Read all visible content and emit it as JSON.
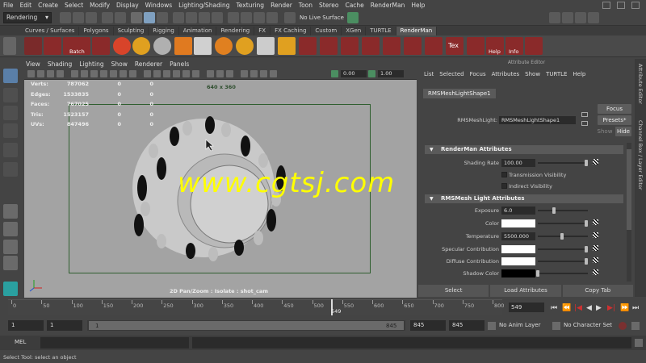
{
  "menubar": [
    "File",
    "Edit",
    "Create",
    "Select",
    "Modify",
    "Display",
    "Windows",
    "Lighting/Shading",
    "Texturing",
    "Render",
    "Toon",
    "Stereo",
    "Cache",
    "RenderMan",
    "Help"
  ],
  "status_line": {
    "mode": "Rendering",
    "live_surface": "No Live Surface"
  },
  "shelf_tabs": [
    "Curves / Surfaces",
    "Polygons",
    "Sculpting",
    "Rigging",
    "Animation",
    "Rendering",
    "FX",
    "FX Caching",
    "Custom",
    "XGen",
    "TURTLE",
    "RenderMan"
  ],
  "shelf_icons": {
    "batch": "Batch",
    "tex": "Tex",
    "help": "Help",
    "info": "Info"
  },
  "viewport": {
    "menu": [
      "View",
      "Shading",
      "Lighting",
      "Show",
      "Renderer",
      "Panels"
    ],
    "toolbar_values": [
      "0.00",
      "1.00"
    ],
    "resolution": "640 x 360",
    "hud": [
      {
        "label": "Verts:",
        "total": "787062",
        "sel": "0",
        "comp": "0"
      },
      {
        "label": "Edges:",
        "total": "1533835",
        "sel": "0",
        "comp": "0"
      },
      {
        "label": "Faces:",
        "total": "767025",
        "sel": "0",
        "comp": "0"
      },
      {
        "label": "Tris:",
        "total": "1523157",
        "sel": "0",
        "comp": "0"
      },
      {
        "label": "UVs:",
        "total": "847496",
        "sel": "0",
        "comp": "0"
      }
    ],
    "footer": "2D Pan/Zoom : Isolate : shot_cam",
    "watermark": "www.cgtsj.com"
  },
  "attribute_editor": {
    "title": "Attribute Editor",
    "menu": [
      "List",
      "Selected",
      "Focus",
      "Attributes",
      "Show",
      "TURTLE",
      "Help"
    ],
    "tab": "RMSMeshLightShape1",
    "node_label": "RMSMeshLight:",
    "node_value": "RMSMeshLightShape1",
    "focus": "Focus",
    "presets": "Presets*",
    "show": "Show",
    "hide": "Hide",
    "sections": {
      "rman": "RenderMan Attributes",
      "light": "RMSMesh  Light Attributes"
    },
    "shading_rate_label": "Shading Rate",
    "shading_rate": "100.00",
    "transmission": "Transmission Visibility",
    "indirect": "Indirect Visibility",
    "exposure_label": "Exposure",
    "exposure": "6.0",
    "color_label": "Color",
    "temperature_label": "Temperature",
    "temperature": "5500.000",
    "specular_label": "Specular Contribution",
    "diffuse_label": "Diffuse Contribution",
    "shadow_label": "Shadow Color",
    "bottom_buttons": [
      "Select",
      "Load Attributes",
      "Copy Tab"
    ],
    "colors": {
      "color_swatch": "#ffffff",
      "shadow_swatch": "#000000"
    }
  },
  "side_tabs": {
    "ae": "Attribute Editor",
    "cb": "Channel Box / Layer Editor"
  },
  "timeline": {
    "ticks": [
      "0",
      "50",
      "100",
      "150",
      "200",
      "250",
      "300",
      "350",
      "400",
      "450",
      "500",
      "550",
      "600",
      "650",
      "700",
      "750",
      "800"
    ],
    "current_marker": "549",
    "current_frame": "549"
  },
  "range": {
    "start": "1",
    "start2": "1",
    "range_start": "1",
    "range_end": "845",
    "end1": "845",
    "end2": "845",
    "anim_layer": "No Anim Layer",
    "char_set": "No Character Set"
  },
  "command_line": {
    "label": "MEL"
  },
  "help_line": "Select Tool: select an object"
}
